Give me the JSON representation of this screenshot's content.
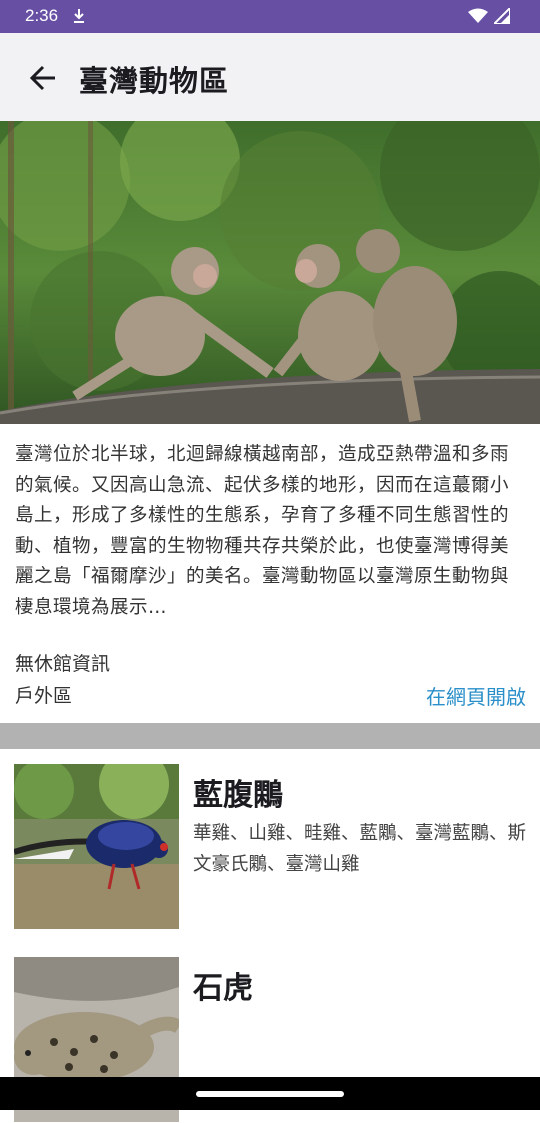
{
  "status": {
    "time": "2:36"
  },
  "app_bar": {
    "title": "臺灣動物區"
  },
  "intro": {
    "text": "臺灣位於北半球，北迴歸線橫越南部，造成亞熱帶溫和多雨的氣候。又因高山急流、起伏多樣的地形，因而在這蕞爾小島上，形成了多樣性的生態系，孕育了多種不同生態習性的動、植物，豐富的生物物種共存共榮於此，也使臺灣博得美麗之島「福爾摩沙」的美名。臺灣動物區以臺灣原生動物與棲息環境為展示…"
  },
  "info": {
    "holiday": "無休館資訊",
    "area": "戶外區",
    "open_web": "在網頁開啟"
  },
  "animals": [
    {
      "name": "藍腹鷴",
      "aliases": "華雞、山雞、畦雞、藍鷴、臺灣藍鷴、斯文豪氏鷴、臺灣山雞"
    },
    {
      "name": "石虎",
      "aliases": ""
    }
  ],
  "colors": {
    "status_bar": "#6750a4",
    "app_bar": "#f2f2f4",
    "link": "#2b8fc9",
    "divider": "#b2b2b2"
  }
}
